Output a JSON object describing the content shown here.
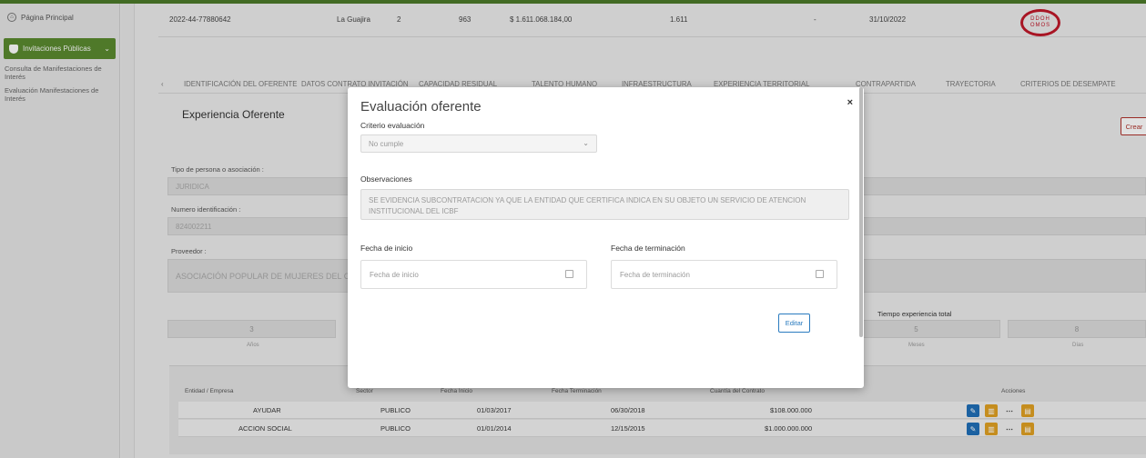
{
  "sidebar": {
    "home": "Página Principal",
    "active": "Invitaciones Públicas",
    "subitems": [
      "Consulta de Manifestaciones de Interés",
      "Evaluación Manifestaciones de Interés"
    ]
  },
  "summary": {
    "id": "2022-44-77880642",
    "region": "La Guajira",
    "num": "2",
    "code": "963",
    "amount": "$ 1.611.068.184,00",
    "value": "1.611",
    "dash": "-",
    "date": "31/10/2022",
    "seal_line1": "DDOH",
    "seal_line2": "OMOS"
  },
  "tabs": {
    "prev": "‹",
    "items": [
      "IDENTIFICACIÓN DEL OFERENTE",
      "DATOS CONTRATO INVITACIÓN",
      "CAPACIDAD RESIDUAL",
      "TALENTO HUMANO",
      "INFRAESTRUCTURA",
      "EXPERIENCIA TERRITORIAL",
      "CONTRAPARTIDA",
      "TRAYECTORIA",
      "CRITERIOS DE DESEMPATE"
    ]
  },
  "card": {
    "title": "Experiencia Oferente",
    "crear": "Crear",
    "tipo_label": "Tipo de persona o asociación :",
    "tipo_value": "JURIDICA",
    "numero_label": "Numero identificación :",
    "numero_value": "824002211",
    "proveedor_label": "Proveedor :",
    "proveedor_value": "ASOCIACIÓN POPULAR DE MUJERES DEL C",
    "tiempo_label": "Tiempo experiencia total",
    "stat1_value": "3",
    "stat1_label": "Años",
    "stat2_value": "5",
    "stat2_label": "Meses",
    "stat3_value": "8",
    "stat3_label": "Días"
  },
  "table": {
    "headers": [
      "Entidad / Empresa",
      "Sector",
      "Fecha Inicio",
      "Fecha Terminación",
      "Cuantía del Contrato",
      "Acciones"
    ],
    "rows": [
      {
        "entidad": "AYUDAR",
        "sector": "PUBLICO",
        "inicio": "01/03/2017",
        "fin": "06/30/2018",
        "cuantia": "$108.000.000"
      },
      {
        "entidad": "ACCION SOCIAL",
        "sector": "PUBLICO",
        "inicio": "01/01/2014",
        "fin": "12/15/2015",
        "cuantia": "$1.000.000.000"
      }
    ]
  },
  "modal": {
    "title": "Evaluación oferente",
    "close": "×",
    "criterio_label": "Criterio evaluación",
    "criterio_value": "No cumple",
    "obs_label": "Observaciones",
    "obs_value": "SE EVIDENCIA SUBCONTRATACION YA QUE LA ENTIDAD QUE CERTIFICA INDICA EN SU OBJETO UN SERVICIO DE ATENCION INSTITUCIONAL DEL ICBF",
    "inicio_label": "Fecha de inicio",
    "inicio_placeholder": "Fecha de inicio",
    "fin_label": "Fecha de terminación",
    "fin_placeholder": "Fecha de terminación",
    "edit": "Editar"
  },
  "colors": {
    "brand_green": "#5a8a2f",
    "seal_red": "#c0182a",
    "action_blue": "#1f6fb8",
    "action_orange": "#e1a123"
  }
}
